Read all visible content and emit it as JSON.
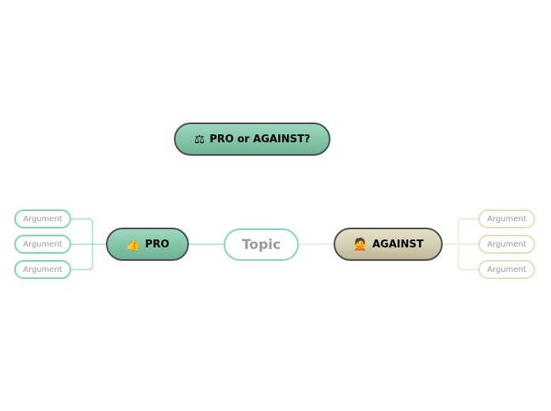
{
  "title_node": {
    "label": "PRO or AGAINST?",
    "icon": "gavel-icon",
    "glyph": "⚖"
  },
  "topic_node": {
    "label": "Topic"
  },
  "pro_node": {
    "label": "PRO",
    "icon": "thumbs-up-icon",
    "glyph": "👍"
  },
  "against_node": {
    "label": "AGAINST",
    "icon": "person-gesturing-no-icon",
    "glyph": "🙅"
  },
  "pro_arguments": [
    {
      "label": "Argument"
    },
    {
      "label": "Argument"
    },
    {
      "label": "Argument"
    }
  ],
  "against_arguments": [
    {
      "label": "Argument"
    },
    {
      "label": "Argument"
    },
    {
      "label": "Argument"
    }
  ],
  "colors": {
    "pro_accent": "#86c8aa",
    "against_accent": "#d6d0b4",
    "topic_border": "#86cfc6",
    "pro_link": "#86cfb1",
    "against_link": "#e5dcbf"
  }
}
